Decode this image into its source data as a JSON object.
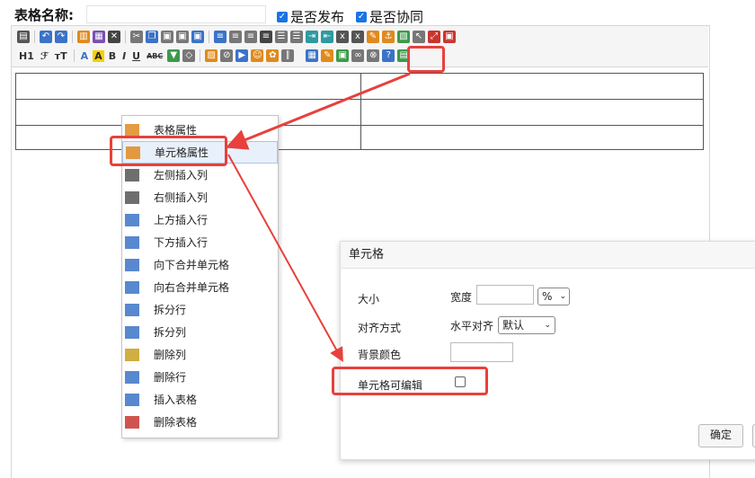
{
  "form": {
    "name_label": "表格名称:",
    "name_value": "",
    "publish_label": "是否发布",
    "publish_checked": true,
    "collab_label": "是否协同",
    "collab_checked": true
  },
  "toolbar": {
    "heading_label": "H1",
    "font_family_label": "ℱ",
    "font_size_label": "тT",
    "font_color_label": "A",
    "bg_color_label": "A",
    "bold_label": "B",
    "italic_label": "I",
    "underline_label": "U",
    "strike_label": "ABC",
    "icon_colors": {
      "blue": "#3b73c8",
      "green": "#3c9a4a",
      "orange": "#e08a1e",
      "red": "#c8362f",
      "gray": "#777777",
      "teal": "#2f9aa0",
      "purple": "#7a4fb0"
    }
  },
  "context_menu": {
    "items": [
      {
        "label": "表格属性",
        "icon": "table-properties-icon"
      },
      {
        "label": "单元格属性",
        "icon": "cell-properties-icon",
        "selected": true
      },
      {
        "label": "左侧插入列",
        "icon": "insert-col-left-icon"
      },
      {
        "label": "右侧插入列",
        "icon": "insert-col-right-icon"
      },
      {
        "label": "上方插入行",
        "icon": "insert-row-above-icon"
      },
      {
        "label": "下方插入行",
        "icon": "insert-row-below-icon"
      },
      {
        "label": "向下合并单元格",
        "icon": "merge-down-icon"
      },
      {
        "label": "向右合并单元格",
        "icon": "merge-right-icon"
      },
      {
        "label": "拆分行",
        "icon": "split-rows-icon"
      },
      {
        "label": "拆分列",
        "icon": "split-cols-icon"
      },
      {
        "label": "删除列",
        "icon": "delete-col-icon"
      },
      {
        "label": "删除行",
        "icon": "delete-row-icon"
      },
      {
        "label": "插入表格",
        "icon": "insert-table-icon"
      },
      {
        "label": "删除表格",
        "icon": "delete-table-icon"
      }
    ]
  },
  "dialog": {
    "title": "单元格",
    "size_label": "大小",
    "width_label": "宽度",
    "width_value": "",
    "width_unit": "%",
    "align_label": "对齐方式",
    "halign_label": "水平对齐",
    "halign_value": "默认",
    "bg_label": "背景颜色",
    "bg_value": "",
    "editable_label": "单元格可编辑",
    "editable_checked": false,
    "confirm_label": "确定"
  },
  "accent": {
    "highlight": "#e8403c",
    "checkbox": "#1a73e8"
  }
}
